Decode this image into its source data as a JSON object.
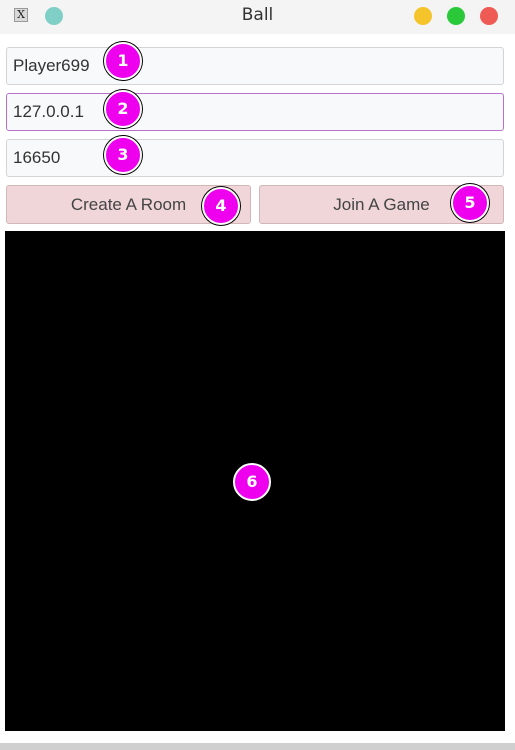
{
  "window": {
    "title": "Ball",
    "app_icon_glyph": "X",
    "colors": {
      "minimize": "#f5c42b",
      "maximize": "#2bc83a",
      "close": "#ef5b54",
      "teal_dot": "#7fcfc6"
    }
  },
  "form": {
    "player_name": "Player699",
    "host": "127.0.0.1",
    "port": "16650"
  },
  "buttons": {
    "create_room": "Create A Room",
    "join_game": "Join A Game"
  },
  "canvas": {
    "background": "#000000"
  },
  "markers": [
    "1",
    "2",
    "3",
    "4",
    "5",
    "6"
  ],
  "marker_color": "#ee00ee"
}
